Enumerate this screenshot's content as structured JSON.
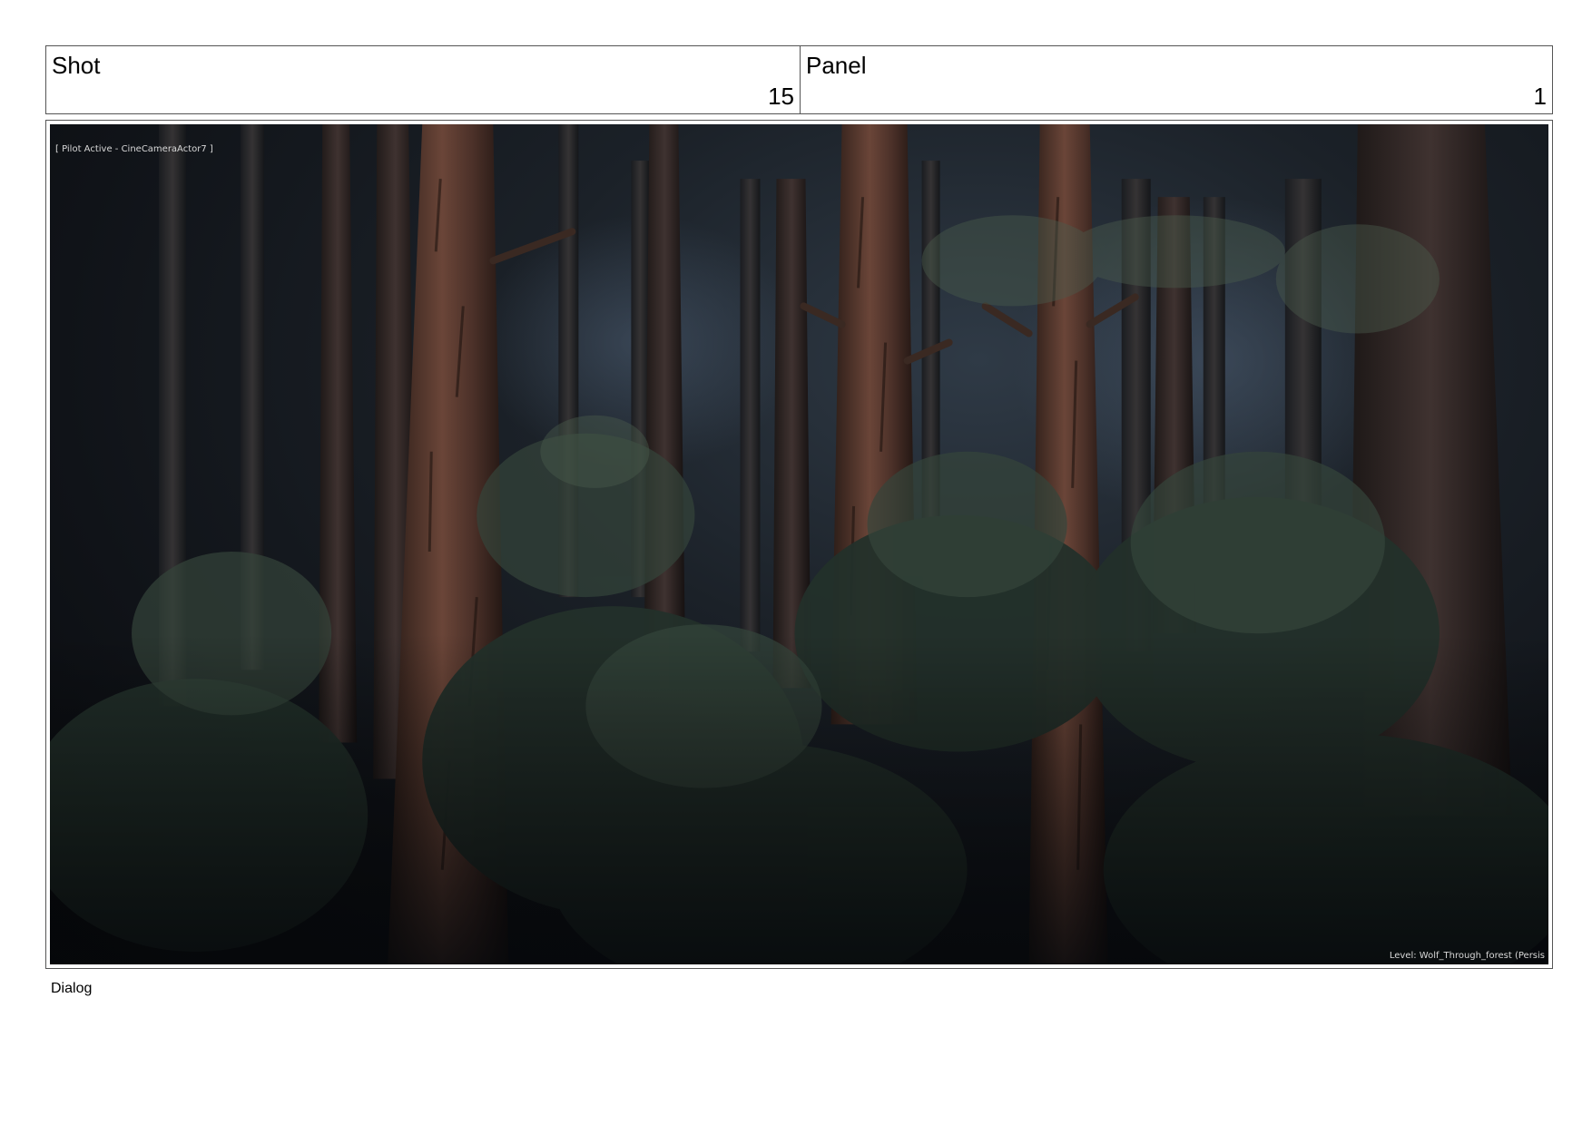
{
  "header": {
    "shot_label": "Shot",
    "shot_value": "15",
    "panel_label": "Panel",
    "panel_value": "1"
  },
  "frame": {
    "pilot_text": "[ Pilot Active - CineCameraActor7 ]",
    "level_text": "Level:  Wolf_Through_forest (Persis"
  },
  "dialog_label": "Dialog"
}
